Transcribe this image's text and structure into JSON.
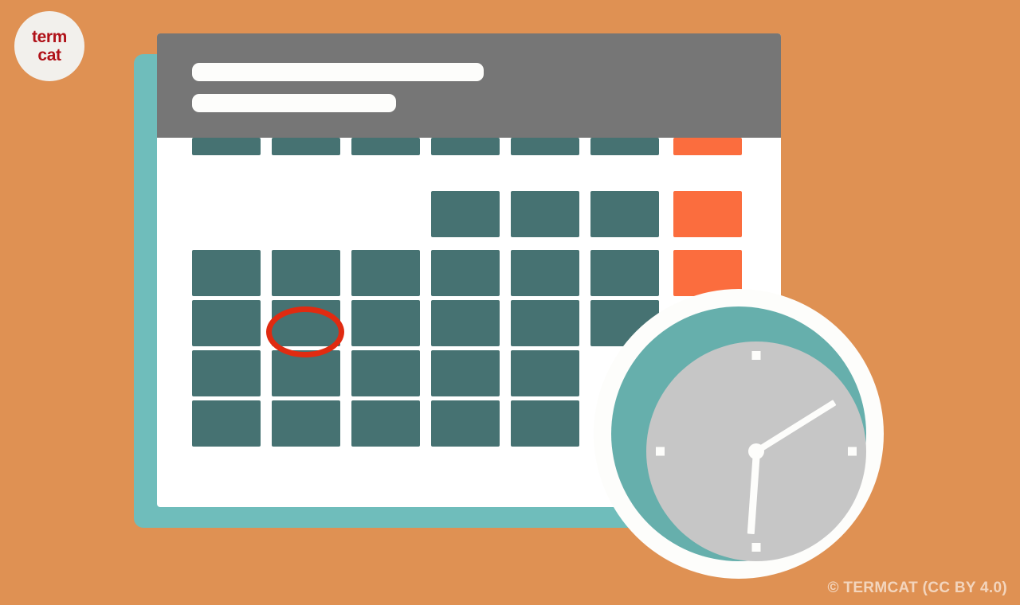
{
  "background_color": "#df9153",
  "logo": {
    "name": "termcat-logo",
    "line1": "term",
    "line2": "cat",
    "text_color": "#b01118",
    "circle_color": "#f2f0ec"
  },
  "copyright": {
    "text": "© TERMCAT (CC BY 4.0)"
  },
  "calendar": {
    "card_color": "#ffffff",
    "shadow_color": "#6fbdbb",
    "header": {
      "bar_color": "#767676",
      "title_placeholder": "",
      "subtitle_placeholder": "",
      "bar_fill": "#fdfdfb"
    },
    "colors": {
      "weekday_cell": "#467272",
      "weekend_cell": "#fb6d3e",
      "highlight_ring": "#e02b11"
    },
    "columns": 7,
    "rows": 6,
    "grid": [
      [
        "weekday",
        "weekday",
        "weekday",
        "weekday",
        "weekday",
        "weekday",
        "weekend"
      ],
      [
        "empty",
        "empty",
        "empty",
        "weekday",
        "weekday",
        "weekday",
        "weekend"
      ],
      [
        "weekday",
        "weekday",
        "weekday",
        "weekday",
        "weekday",
        "weekday",
        "weekend"
      ],
      [
        "weekday",
        "weekday",
        "weekday",
        "weekday",
        "weekday",
        "weekday",
        "empty"
      ],
      [
        "weekday",
        "weekday",
        "weekday",
        "weekday",
        "weekday",
        "empty",
        "empty"
      ],
      [
        "weekday",
        "weekday",
        "weekday",
        "weekday",
        "weekday",
        "empty",
        "empty"
      ]
    ],
    "highlighted_cell": {
      "row": 3,
      "col": 1
    }
  },
  "clock": {
    "outer_ring_color": "#fdfdfb",
    "bezel_color": "#66afac",
    "face_color": "#c6c6c6",
    "hand_color": "#fdfdfb",
    "tick_positions": [
      "12",
      "3",
      "6",
      "9"
    ],
    "hour_angle_deg": 184,
    "minute_angle_deg": 58,
    "reading": "6:10"
  }
}
